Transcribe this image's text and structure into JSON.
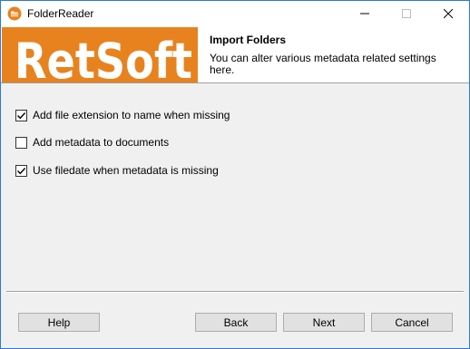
{
  "window": {
    "title": "FolderReader",
    "icon": "folder-icon",
    "controls": {
      "minimize": "minimize-icon",
      "maximize": "maximize-icon",
      "close": "close-icon"
    }
  },
  "header": {
    "logo_text": "RetSoft",
    "title": "Import Folders",
    "description": "You can alter various metadata related settings here."
  },
  "options": [
    {
      "label": "Add file extension to name when missing",
      "checked": true
    },
    {
      "label": "Add metadata to documents",
      "checked": false
    },
    {
      "label": "Use filedate when metadata is missing",
      "checked": true
    }
  ],
  "buttons": {
    "help": "Help",
    "back": "Back",
    "next": "Next",
    "cancel": "Cancel"
  },
  "colors": {
    "logo_background": "#e8821e",
    "logo_text": "#ffffff",
    "window_border": "#2b7ad4"
  }
}
